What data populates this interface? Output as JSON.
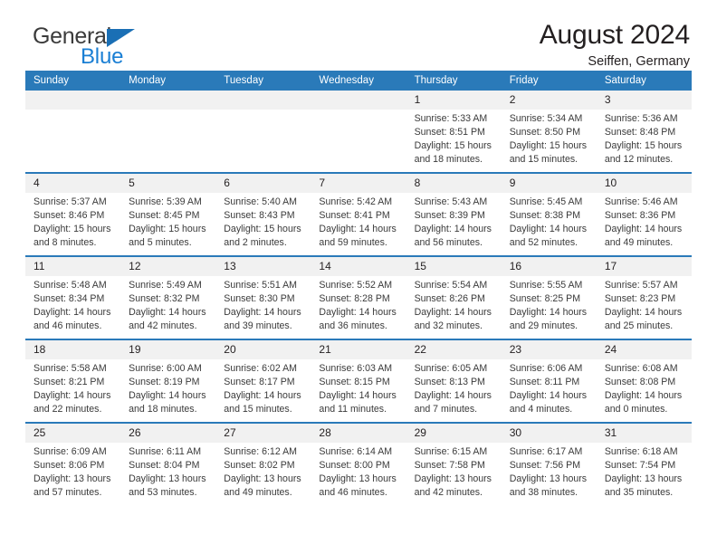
{
  "brand": {
    "word_one": "General",
    "word_two": "Blue",
    "triangle_icon": "triangle-icon",
    "colors": {
      "general": "#3b3b3b",
      "blue": "#1a7fd4",
      "triangle": "#1a6fb5"
    }
  },
  "header": {
    "title": "August 2024",
    "subtitle": "Seiffen, Germany"
  },
  "theme": {
    "header_blue": "#2a7ab9",
    "daynum_gray": "#f1f1f1",
    "text": "#231f20"
  },
  "weekday_headers": [
    "Sunday",
    "Monday",
    "Tuesday",
    "Wednesday",
    "Thursday",
    "Friday",
    "Saturday"
  ],
  "weeks": [
    [
      {
        "day": "",
        "lines": []
      },
      {
        "day": "",
        "lines": []
      },
      {
        "day": "",
        "lines": []
      },
      {
        "day": "",
        "lines": []
      },
      {
        "day": "1",
        "lines": [
          "Sunrise: 5:33 AM",
          "Sunset: 8:51 PM",
          "Daylight: 15 hours",
          "and 18 minutes."
        ]
      },
      {
        "day": "2",
        "lines": [
          "Sunrise: 5:34 AM",
          "Sunset: 8:50 PM",
          "Daylight: 15 hours",
          "and 15 minutes."
        ]
      },
      {
        "day": "3",
        "lines": [
          "Sunrise: 5:36 AM",
          "Sunset: 8:48 PM",
          "Daylight: 15 hours",
          "and 12 minutes."
        ]
      }
    ],
    [
      {
        "day": "4",
        "lines": [
          "Sunrise: 5:37 AM",
          "Sunset: 8:46 PM",
          "Daylight: 15 hours",
          "and 8 minutes."
        ]
      },
      {
        "day": "5",
        "lines": [
          "Sunrise: 5:39 AM",
          "Sunset: 8:45 PM",
          "Daylight: 15 hours",
          "and 5 minutes."
        ]
      },
      {
        "day": "6",
        "lines": [
          "Sunrise: 5:40 AM",
          "Sunset: 8:43 PM",
          "Daylight: 15 hours",
          "and 2 minutes."
        ]
      },
      {
        "day": "7",
        "lines": [
          "Sunrise: 5:42 AM",
          "Sunset: 8:41 PM",
          "Daylight: 14 hours",
          "and 59 minutes."
        ]
      },
      {
        "day": "8",
        "lines": [
          "Sunrise: 5:43 AM",
          "Sunset: 8:39 PM",
          "Daylight: 14 hours",
          "and 56 minutes."
        ]
      },
      {
        "day": "9",
        "lines": [
          "Sunrise: 5:45 AM",
          "Sunset: 8:38 PM",
          "Daylight: 14 hours",
          "and 52 minutes."
        ]
      },
      {
        "day": "10",
        "lines": [
          "Sunrise: 5:46 AM",
          "Sunset: 8:36 PM",
          "Daylight: 14 hours",
          "and 49 minutes."
        ]
      }
    ],
    [
      {
        "day": "11",
        "lines": [
          "Sunrise: 5:48 AM",
          "Sunset: 8:34 PM",
          "Daylight: 14 hours",
          "and 46 minutes."
        ]
      },
      {
        "day": "12",
        "lines": [
          "Sunrise: 5:49 AM",
          "Sunset: 8:32 PM",
          "Daylight: 14 hours",
          "and 42 minutes."
        ]
      },
      {
        "day": "13",
        "lines": [
          "Sunrise: 5:51 AM",
          "Sunset: 8:30 PM",
          "Daylight: 14 hours",
          "and 39 minutes."
        ]
      },
      {
        "day": "14",
        "lines": [
          "Sunrise: 5:52 AM",
          "Sunset: 8:28 PM",
          "Daylight: 14 hours",
          "and 36 minutes."
        ]
      },
      {
        "day": "15",
        "lines": [
          "Sunrise: 5:54 AM",
          "Sunset: 8:26 PM",
          "Daylight: 14 hours",
          "and 32 minutes."
        ]
      },
      {
        "day": "16",
        "lines": [
          "Sunrise: 5:55 AM",
          "Sunset: 8:25 PM",
          "Daylight: 14 hours",
          "and 29 minutes."
        ]
      },
      {
        "day": "17",
        "lines": [
          "Sunrise: 5:57 AM",
          "Sunset: 8:23 PM",
          "Daylight: 14 hours",
          "and 25 minutes."
        ]
      }
    ],
    [
      {
        "day": "18",
        "lines": [
          "Sunrise: 5:58 AM",
          "Sunset: 8:21 PM",
          "Daylight: 14 hours",
          "and 22 minutes."
        ]
      },
      {
        "day": "19",
        "lines": [
          "Sunrise: 6:00 AM",
          "Sunset: 8:19 PM",
          "Daylight: 14 hours",
          "and 18 minutes."
        ]
      },
      {
        "day": "20",
        "lines": [
          "Sunrise: 6:02 AM",
          "Sunset: 8:17 PM",
          "Daylight: 14 hours",
          "and 15 minutes."
        ]
      },
      {
        "day": "21",
        "lines": [
          "Sunrise: 6:03 AM",
          "Sunset: 8:15 PM",
          "Daylight: 14 hours",
          "and 11 minutes."
        ]
      },
      {
        "day": "22",
        "lines": [
          "Sunrise: 6:05 AM",
          "Sunset: 8:13 PM",
          "Daylight: 14 hours",
          "and 7 minutes."
        ]
      },
      {
        "day": "23",
        "lines": [
          "Sunrise: 6:06 AM",
          "Sunset: 8:11 PM",
          "Daylight: 14 hours",
          "and 4 minutes."
        ]
      },
      {
        "day": "24",
        "lines": [
          "Sunrise: 6:08 AM",
          "Sunset: 8:08 PM",
          "Daylight: 14 hours",
          "and 0 minutes."
        ]
      }
    ],
    [
      {
        "day": "25",
        "lines": [
          "Sunrise: 6:09 AM",
          "Sunset: 8:06 PM",
          "Daylight: 13 hours",
          "and 57 minutes."
        ]
      },
      {
        "day": "26",
        "lines": [
          "Sunrise: 6:11 AM",
          "Sunset: 8:04 PM",
          "Daylight: 13 hours",
          "and 53 minutes."
        ]
      },
      {
        "day": "27",
        "lines": [
          "Sunrise: 6:12 AM",
          "Sunset: 8:02 PM",
          "Daylight: 13 hours",
          "and 49 minutes."
        ]
      },
      {
        "day": "28",
        "lines": [
          "Sunrise: 6:14 AM",
          "Sunset: 8:00 PM",
          "Daylight: 13 hours",
          "and 46 minutes."
        ]
      },
      {
        "day": "29",
        "lines": [
          "Sunrise: 6:15 AM",
          "Sunset: 7:58 PM",
          "Daylight: 13 hours",
          "and 42 minutes."
        ]
      },
      {
        "day": "30",
        "lines": [
          "Sunrise: 6:17 AM",
          "Sunset: 7:56 PM",
          "Daylight: 13 hours",
          "and 38 minutes."
        ]
      },
      {
        "day": "31",
        "lines": [
          "Sunrise: 6:18 AM",
          "Sunset: 7:54 PM",
          "Daylight: 13 hours",
          "and 35 minutes."
        ]
      }
    ]
  ]
}
